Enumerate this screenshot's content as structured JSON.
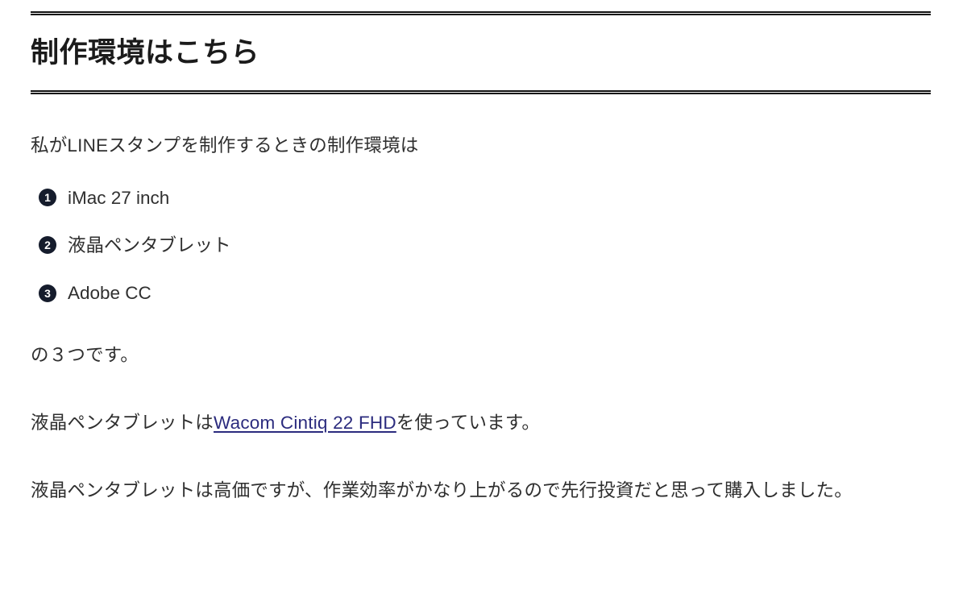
{
  "article": {
    "heading": "制作環境はこちら",
    "intro_paragraph": "私がLINEスタンプを制作するときの制作環境は",
    "spec_list": [
      {
        "marker": "1",
        "label": "iMac 27 inch"
      },
      {
        "marker": "2",
        "label": "液晶ペンタブレット"
      },
      {
        "marker": "3",
        "label": "Adobe CC"
      }
    ],
    "count_paragraph": "の３つです。",
    "link_paragraph": {
      "before": "液晶ペンタブレットは",
      "link_text": "Wacom Cintiq 22 FHD",
      "after": "を使っています。"
    },
    "closing_paragraph": "液晶ペンタブレットは高価ですが、作業効率がかなり上がるので先行投資だと思って購入しました。"
  },
  "theme": {
    "background": "#ffffff",
    "text_color": "#2f2f2f",
    "heading_color": "#1b1b1b",
    "rule_color": "#111111",
    "marker_background": "#151c2c",
    "marker_text": "#ffffff",
    "link_color": "#2b2b7e"
  }
}
